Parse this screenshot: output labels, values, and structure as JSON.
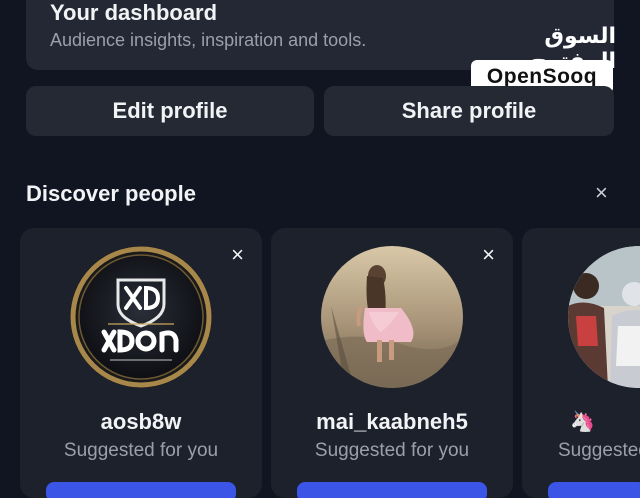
{
  "dashboard": {
    "title": "Your dashboard",
    "subtitle": "Audience insights, inspiration and tools."
  },
  "watermark": {
    "arabic": "السوق المفتوح",
    "latin": "OpenSooq"
  },
  "profile_actions": {
    "edit_label": "Edit profile",
    "share_label": "Share profile"
  },
  "discover": {
    "title": "Discover people",
    "close_icon": "×",
    "cards": [
      {
        "username": "aosb8w",
        "subtitle": "Suggested for you",
        "close_icon": "×",
        "avatar": "xdon-logo"
      },
      {
        "username": "mai_kaabneh5",
        "subtitle": "Suggested for you",
        "close_icon": "×",
        "avatar": "child-photo"
      },
      {
        "username": "🦄",
        "subtitle": "Suggested",
        "avatar": "group-photo"
      }
    ]
  },
  "colors": {
    "background": "#111521",
    "card": "#1c212c",
    "button": "#242934",
    "muted_text": "#9aa0aa",
    "accent": "#3b55e6"
  }
}
